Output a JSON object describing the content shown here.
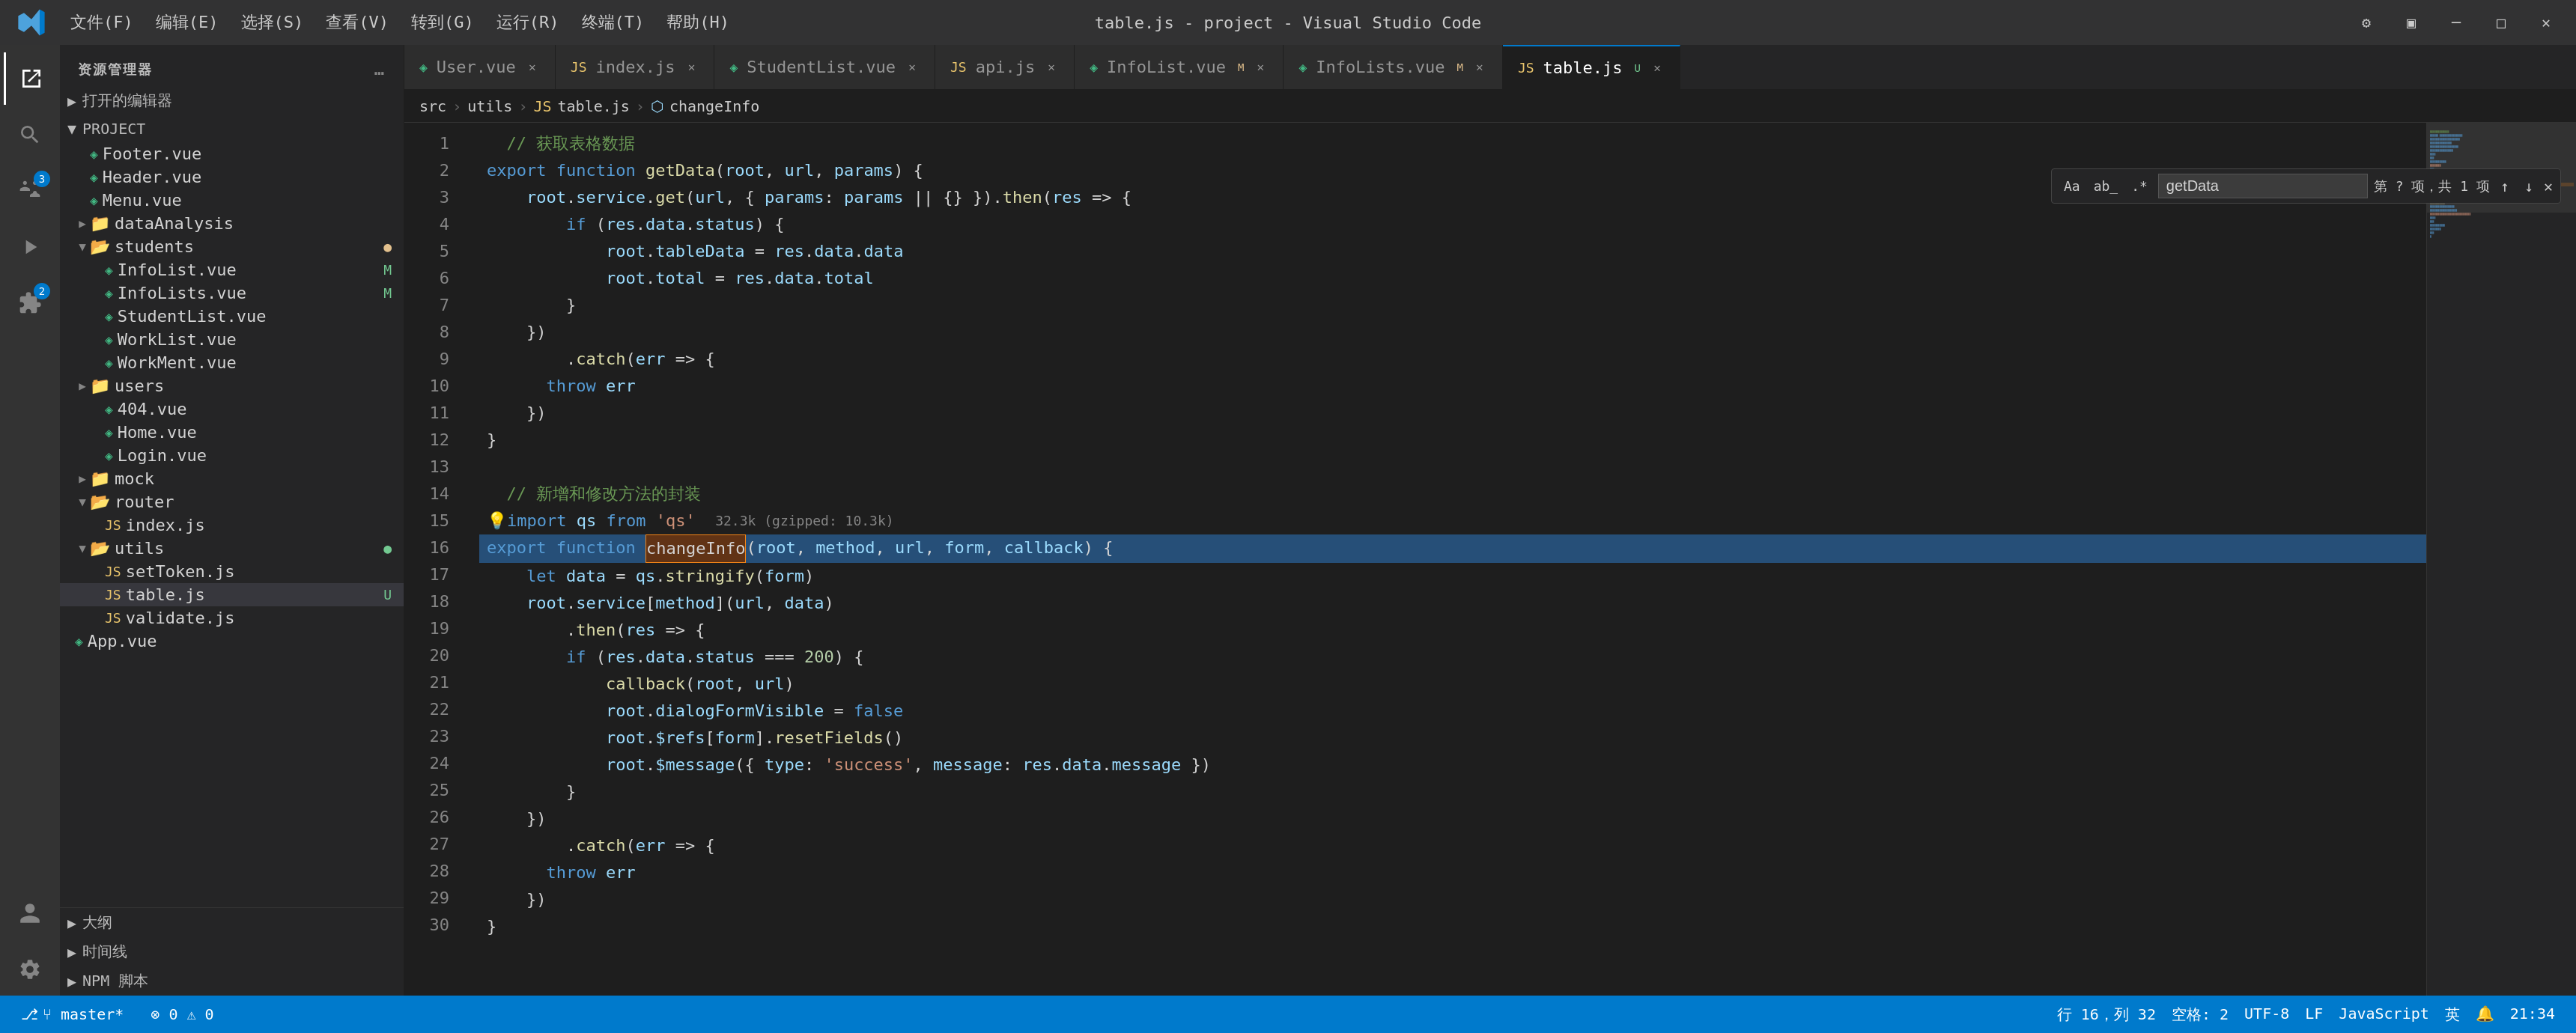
{
  "titlebar": {
    "title": "table.js - project - Visual Studio Code",
    "menu": [
      "文件(F)",
      "编辑(E)",
      "选择(S)",
      "查看(V)",
      "转到(G)",
      "运行(R)",
      "终端(T)",
      "帮助(H)"
    ]
  },
  "sidebar": {
    "header": "资源管理器",
    "project_label": "PROJECT",
    "打开的编辑器": "打开的编辑器",
    "sections": {
      "outline": "大纲",
      "timeline": "时间线",
      "npm": "NPM 脚本"
    },
    "tree": [
      {
        "type": "folder",
        "name": "Footer.vue",
        "indent": 2,
        "icon": "vue",
        "badge": ""
      },
      {
        "type": "folder",
        "name": "Header.vue",
        "indent": 2,
        "icon": "vue",
        "badge": ""
      },
      {
        "type": "folder",
        "name": "Menu.vue",
        "indent": 2,
        "icon": "vue",
        "badge": ""
      },
      {
        "type": "folder",
        "name": "dataAnalysis",
        "indent": 1,
        "icon": "folder",
        "badge": ""
      },
      {
        "type": "folder",
        "name": "students",
        "indent": 1,
        "icon": "folder",
        "badge": "●",
        "badge_color": "modified"
      },
      {
        "type": "file",
        "name": "InfoList.vue",
        "indent": 2,
        "icon": "vue",
        "badge": "M"
      },
      {
        "type": "file",
        "name": "InfoLists.vue",
        "indent": 2,
        "icon": "vue",
        "badge": "M"
      },
      {
        "type": "file",
        "name": "StudentList.vue",
        "indent": 2,
        "icon": "vue",
        "badge": ""
      },
      {
        "type": "file",
        "name": "WorkList.vue",
        "indent": 2,
        "icon": "vue",
        "badge": ""
      },
      {
        "type": "file",
        "name": "WorkMent.vue",
        "indent": 2,
        "icon": "vue",
        "badge": ""
      },
      {
        "type": "folder",
        "name": "users",
        "indent": 1,
        "icon": "folder",
        "badge": ""
      },
      {
        "type": "folder",
        "name": "404.vue",
        "indent": 2,
        "icon": "vue",
        "badge": ""
      },
      {
        "type": "file",
        "name": "Home.vue",
        "indent": 2,
        "icon": "vue",
        "badge": ""
      },
      {
        "type": "file",
        "name": "Login.vue",
        "indent": 2,
        "icon": "vue",
        "badge": ""
      },
      {
        "type": "folder",
        "name": "mock",
        "indent": 1,
        "icon": "folder",
        "badge": ""
      },
      {
        "type": "folder",
        "name": "router",
        "indent": 1,
        "icon": "folder",
        "badge": ""
      },
      {
        "type": "file",
        "name": "index.js",
        "indent": 2,
        "icon": "js",
        "badge": ""
      },
      {
        "type": "folder",
        "name": "utils",
        "indent": 1,
        "icon": "folder",
        "badge": "●",
        "badge_color": "green"
      },
      {
        "type": "file",
        "name": "setToken.js",
        "indent": 2,
        "icon": "js",
        "badge": ""
      },
      {
        "type": "file",
        "name": "table.js",
        "indent": 2,
        "icon": "js",
        "badge": "U",
        "active": true
      },
      {
        "type": "file",
        "name": "validate.js",
        "indent": 2,
        "icon": "js",
        "badge": ""
      },
      {
        "type": "file",
        "name": "App.vue",
        "indent": 1,
        "icon": "vue",
        "badge": ""
      }
    ]
  },
  "tabs": [
    {
      "label": "User.vue",
      "icon": "vue",
      "active": false,
      "modified": false
    },
    {
      "label": "index.js",
      "icon": "js",
      "active": false,
      "modified": false
    },
    {
      "label": "StudentList.vue",
      "icon": "vue",
      "active": false,
      "modified": false
    },
    {
      "label": "api.js",
      "icon": "js",
      "active": false,
      "modified": false
    },
    {
      "label": "InfoList.vue",
      "icon": "vue",
      "active": false,
      "modified": true
    },
    {
      "label": "InfoLists.vue",
      "icon": "vue",
      "active": false,
      "modified": true
    },
    {
      "label": "table.js",
      "icon": "js",
      "active": true,
      "modified": true
    }
  ],
  "breadcrumb": {
    "parts": [
      "src",
      "utils",
      "JS table.js",
      "⬡ changeInfo"
    ]
  },
  "find": {
    "query": "getData",
    "count_text": "第 ? 项，共 1 项"
  },
  "code": {
    "lines": [
      {
        "n": 1,
        "content": "comment",
        "text": "  // 获取表格数据"
      },
      {
        "n": 2,
        "content": "export function getData"
      },
      {
        "n": 3,
        "content": "  root.service.get"
      },
      {
        "n": 4,
        "content": "    if (res.data.status) {"
      },
      {
        "n": 5,
        "content": "      root.tableData = res.data.data"
      },
      {
        "n": 6,
        "content": "      root.total = res.data.total"
      },
      {
        "n": 7,
        "content": "    }"
      },
      {
        "n": 8,
        "content": "  })"
      },
      {
        "n": 9,
        "content": "    .catch(err => {"
      },
      {
        "n": 10,
        "content": "      throw err"
      },
      {
        "n": 11,
        "content": "  })"
      },
      {
        "n": 12,
        "content": "}"
      },
      {
        "n": 13,
        "content": ""
      },
      {
        "n": 14,
        "content": "  // 新增和修改方法的封装"
      },
      {
        "n": 15,
        "content": "import qs from 'qs'"
      },
      {
        "n": 16,
        "content": "export function changeInfo highlight"
      },
      {
        "n": 17,
        "content": "  let data = qs.stringify(form)"
      },
      {
        "n": 18,
        "content": "  root.service[method](url, data)"
      },
      {
        "n": 19,
        "content": "    .then(res => {"
      },
      {
        "n": 20,
        "content": "    if (res.data.status === 200) {"
      },
      {
        "n": 21,
        "content": "      callback(root, url)"
      },
      {
        "n": 22,
        "content": "      root.dialogFormVisible = false"
      },
      {
        "n": 23,
        "content": "      root.$refs[form].resetFields()"
      },
      {
        "n": 24,
        "content": "      root.$message({ type: 'success', message: res.data.message })"
      },
      {
        "n": 25,
        "content": "    }"
      },
      {
        "n": 26,
        "content": "  })"
      },
      {
        "n": 27,
        "content": "    .catch(err => {"
      },
      {
        "n": 28,
        "content": "      throw err"
      },
      {
        "n": 29,
        "content": "  })"
      },
      {
        "n": 30,
        "content": "}"
      }
    ]
  },
  "statusbar": {
    "git": "⑂ master*",
    "errors": "⊗ 0  ⚠ 0",
    "encoding": "UTF-8",
    "eol": "LF",
    "language": "JavaScript",
    "spaces": "空格: 2",
    "position": "行 16，列 32",
    "lang_select": "英",
    "time": "21:34"
  }
}
